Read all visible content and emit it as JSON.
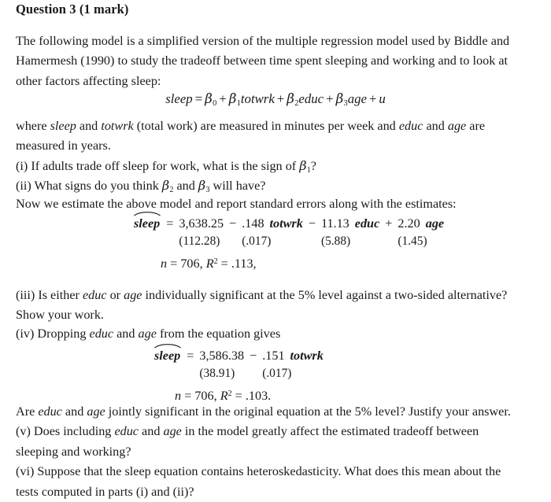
{
  "heading": "Question 3 (1 mark)",
  "intro": {
    "line1": "The following model is a simplified version of the multiple regression model used by Biddle and",
    "line2": "Hamermesh (1990) to study the tradeoff between time spent sleeping and working and to look at",
    "line3": "other factors affecting sleep:"
  },
  "model_equation": {
    "lhs": "sleep",
    "equals": "=",
    "beta0": "β",
    "beta0_sub": "0",
    "plus1": "+",
    "beta1": "β",
    "beta1_sub": "1",
    "var1": "totwrk",
    "plus2": "+",
    "beta2": "β",
    "beta2_sub": "2",
    "var2": "educ",
    "plus3": "+",
    "beta3": "β",
    "beta3_sub": "3",
    "var3": "age",
    "plus4": "+",
    "error": "u"
  },
  "where": {
    "w1": "where ",
    "w_sleep": "sleep",
    "w2": " and ",
    "w_totwrk": "totwrk",
    "w3": " (total work) are measured in minutes per week and ",
    "w_educ": "educ",
    "w4": " and ",
    "w_age": "age",
    "w5": " are",
    "w6": "measured in years."
  },
  "questions": {
    "i_pre": "(i) If adults trade off sleep for work, what is the sign of ",
    "i_beta": "β",
    "i_sub": "1",
    "i_post": "?",
    "ii_pre": "(ii) What signs do you think ",
    "ii_beta_a": "β",
    "ii_sub_a": "2",
    "ii_mid": " and ",
    "ii_beta_b": "β",
    "ii_sub_b": "3",
    "ii_post": " will have?",
    "now_estimate": "Now we estimate the above model and report standard errors along with the estimates:",
    "iii_a": "(iii) Is either ",
    "iii_educ": "educ",
    "iii_b": " or ",
    "iii_age": "age",
    "iii_c": " individually significant at the 5% level against a two-sided alternative?",
    "iii_d": "Show your work.",
    "iv_a": "(iv) Dropping ",
    "iv_educ": "educ",
    "iv_b": " and ",
    "iv_age": "age",
    "iv_c": " from the equation gives",
    "jointly_a": "Are ",
    "jointly_educ": "educ",
    "jointly_b": " and ",
    "jointly_age": "age",
    "jointly_c": " jointly significant in the original equation at the 5% level? Justify your answer.",
    "v_a": "(v) Does including ",
    "v_educ": "educ",
    "v_b": " and ",
    "v_age": "age",
    "v_c": " in the model greatly affect the estimated tradeoff between",
    "v_d": "sleeping and working?",
    "vi_a": "(vi) Suppose that the sleep equation contains heteroskedasticity. What does this mean about the",
    "vi_b": "tests computed in parts (i) and (ii)?"
  },
  "regression1": {
    "lhs": "sleep",
    "equals": "=",
    "intercept": "3,638.25",
    "intercept_se": "(112.28)",
    "sign1": "−",
    "coef1": ".148",
    "var1": "totwrk",
    "coef1_se": "(.017)",
    "sign2": "−",
    "coef2": "11.13",
    "var2": "educ",
    "coef2_se": "(5.88)",
    "sign3": "+",
    "coef3": "2.20",
    "var3": "age",
    "coef3_se": "(1.45)",
    "n_label": "n",
    "n_eq": "= 706,",
    "r_label": "R",
    "r_sup": "2",
    "r_value": "= .113,"
  },
  "regression2": {
    "lhs": "sleep",
    "equals": "=",
    "intercept": "3,586.38",
    "intercept_se": "(38.91)",
    "sign1": "−",
    "coef1": ".151",
    "var1": "totwrk",
    "coef1_se": "(.017)",
    "n_label": "n",
    "n_eq": "= 706,",
    "r_label": "R",
    "r_sup": "2",
    "r_value": "= .103."
  }
}
